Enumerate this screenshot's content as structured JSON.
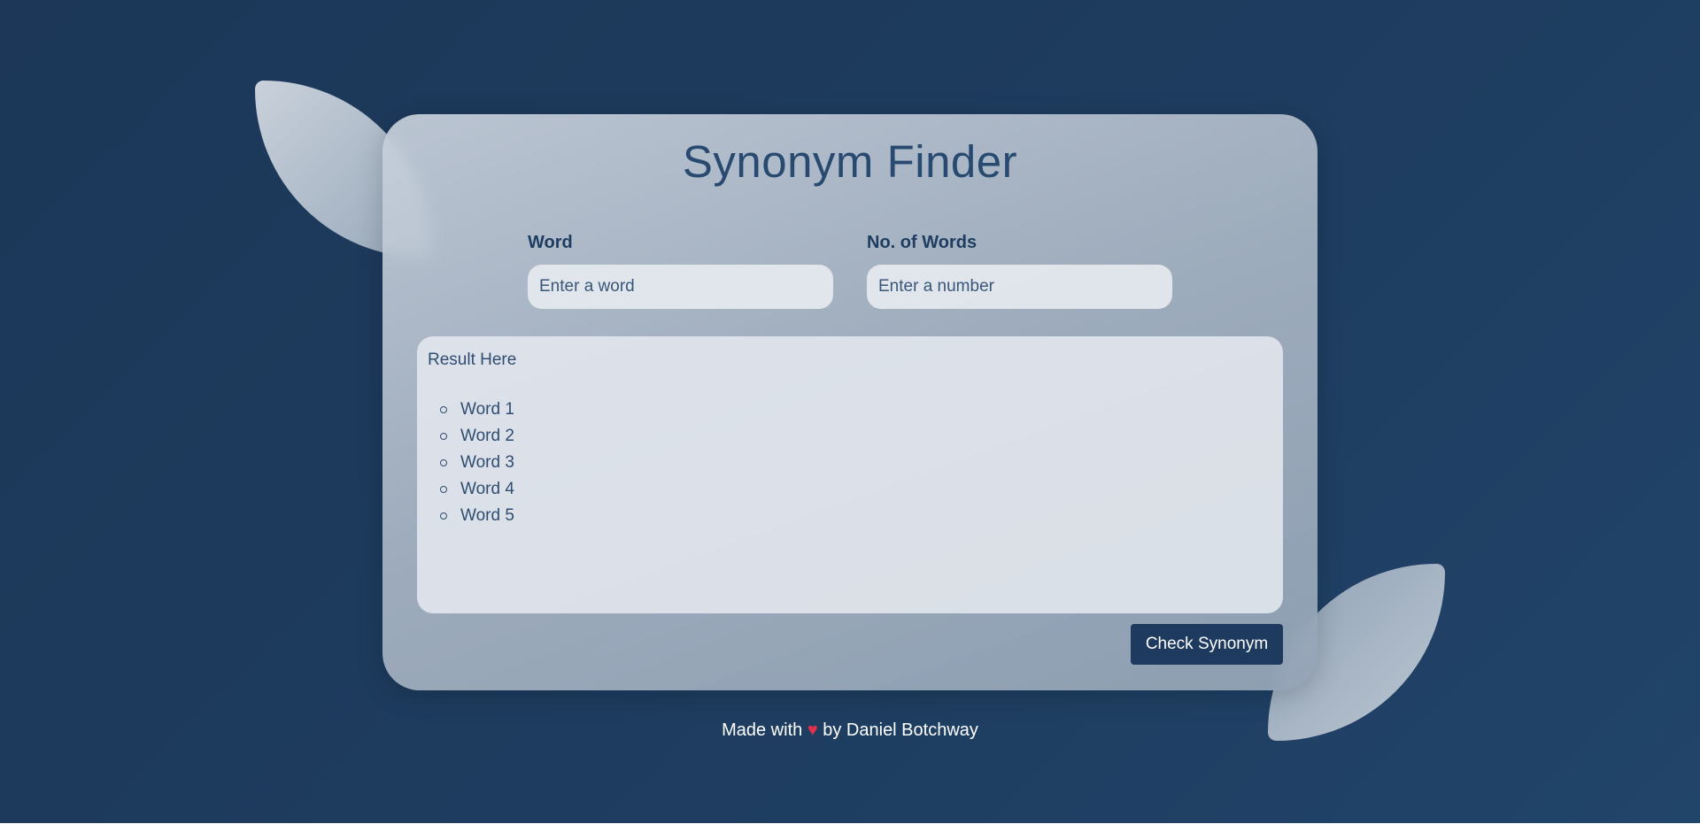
{
  "page": {
    "title": "Synonym Finder"
  },
  "form": {
    "word_label": "Word",
    "word_placeholder": "Enter a word",
    "word_value": "",
    "count_label": "No. of Words",
    "count_placeholder": "Enter a number",
    "count_value": ""
  },
  "result": {
    "heading": "Result Here",
    "items": [
      "Word 1",
      "Word 2",
      "Word 3",
      "Word 4",
      "Word 5"
    ]
  },
  "actions": {
    "check_label": "Check Synonym"
  },
  "footer": {
    "prefix": "Made with",
    "heart_icon": "heart-icon",
    "heart_glyph": "♥",
    "suffix": "by Daniel Botchway"
  },
  "colors": {
    "background": "#1e3d60",
    "accent": "#1e3a5f",
    "heart": "#e0304a"
  }
}
